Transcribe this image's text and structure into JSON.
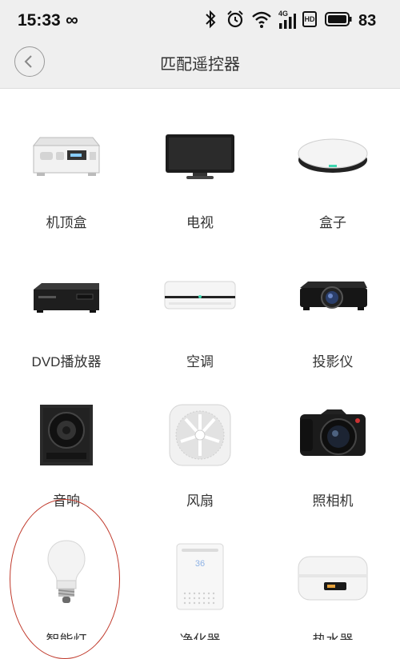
{
  "status_bar": {
    "time": "15:33",
    "loop_symbol": "∞",
    "network": "4G",
    "hd_label": "HD",
    "battery": "83"
  },
  "header": {
    "title": "匹配遥控器"
  },
  "devices": [
    {
      "label": "机顶盒",
      "icon": "set-top-box-icon"
    },
    {
      "label": "电视",
      "icon": "tv-icon"
    },
    {
      "label": "盒子",
      "icon": "tv-box-icon"
    },
    {
      "label": "DVD播放器",
      "icon": "dvd-player-icon"
    },
    {
      "label": "空调",
      "icon": "air-conditioner-icon"
    },
    {
      "label": "投影仪",
      "icon": "projector-icon"
    },
    {
      "label": "音响",
      "icon": "speaker-icon"
    },
    {
      "label": "风扇",
      "icon": "fan-icon"
    },
    {
      "label": "照相机",
      "icon": "camera-icon"
    },
    {
      "label": "智能灯",
      "icon": "smart-bulb-icon"
    },
    {
      "label": "净化器",
      "icon": "air-purifier-icon"
    },
    {
      "label": "热水器",
      "icon": "water-heater-icon"
    }
  ],
  "purifier_display": "36",
  "colors": {
    "header_bg": "#efefef",
    "annotation": "#c0392b"
  }
}
